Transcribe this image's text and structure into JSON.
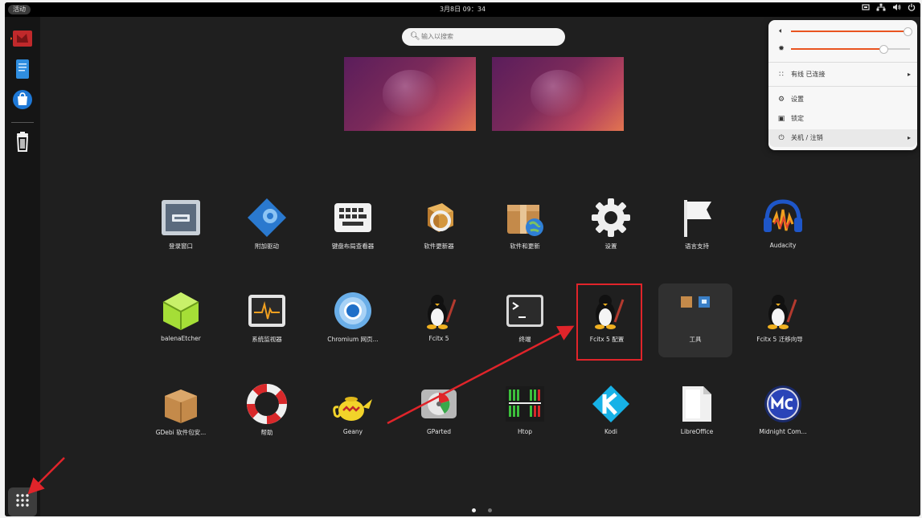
{
  "topbar": {
    "activities": "活动",
    "clock": "3月8日 09：34",
    "tray_icons": [
      "display-icon",
      "network-icon",
      "volume-icon",
      "power-icon"
    ]
  },
  "dock": {
    "items": [
      "flag-app-icon",
      "text-editor-icon",
      "ubuntu-software-icon",
      "trash-icon"
    ],
    "show_apps": "grid-icon"
  },
  "search": {
    "placeholder": "输入以搜索"
  },
  "apps": {
    "row1": [
      {
        "label": "登录窗口",
        "icon": "login-window-icon"
      },
      {
        "label": "附加驱动",
        "icon": "additional-drivers-icon"
      },
      {
        "label": "键盘布局查看器",
        "icon": "keyboard-icon"
      },
      {
        "label": "软件更新器",
        "icon": "software-updater-icon"
      },
      {
        "label": "软件和更新",
        "icon": "software-sources-icon"
      },
      {
        "label": "设置",
        "icon": "settings-gear-icon"
      },
      {
        "label": "语言支持",
        "icon": "language-flag-icon"
      },
      {
        "label": "Audacity",
        "icon": "audacity-icon"
      }
    ],
    "row2": [
      {
        "label": "balenaEtcher",
        "icon": "balena-etcher-icon"
      },
      {
        "label": "系统监视器",
        "icon": "system-monitor-icon"
      },
      {
        "label": "Chromium 网页...",
        "icon": "chromium-icon"
      },
      {
        "label": "Fcitx 5",
        "icon": "fcitx-penguin-icon"
      },
      {
        "label": "终端",
        "icon": "terminal-icon"
      },
      {
        "label": "Fcitx 5 配置",
        "icon": "fcitx-config-penguin-icon"
      },
      {
        "label": "工具",
        "icon": "utilities-folder-icon"
      },
      {
        "label": "Fcitx 5 迁移向导",
        "icon": "fcitx-migrator-penguin-icon"
      }
    ],
    "row3": [
      {
        "label": "GDebi 软件包安...",
        "icon": "gdebi-box-icon"
      },
      {
        "label": "帮助",
        "icon": "help-lifebuoy-icon"
      },
      {
        "label": "Geany",
        "icon": "geany-teapot-icon"
      },
      {
        "label": "GParted",
        "icon": "gparted-disk-icon"
      },
      {
        "label": "Htop",
        "icon": "htop-icon"
      },
      {
        "label": "Kodi",
        "icon": "kodi-icon"
      },
      {
        "label": "LibreOffice",
        "icon": "libreoffice-icon"
      },
      {
        "label": "Midnight Com...",
        "icon": "midnight-commander-icon"
      }
    ]
  },
  "quick_settings": {
    "volume_level": 0.98,
    "brightness_level": 0.78,
    "wired": "有线 已连接",
    "settings": "设置",
    "lock": "锁定",
    "power": "关机 / 注销"
  },
  "pager": {
    "pages": 2,
    "current": 1
  },
  "colors": {
    "accent": "#e95420",
    "annotation": "#e0242a",
    "background": "#1f1f1f"
  }
}
